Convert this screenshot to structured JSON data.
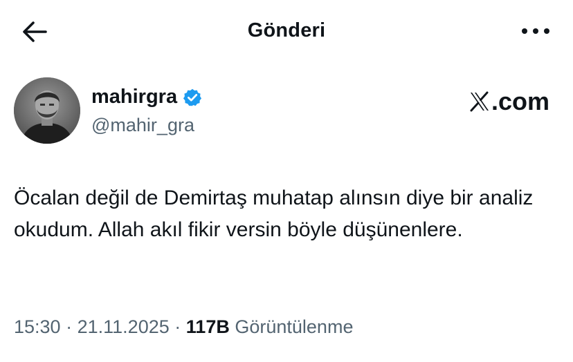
{
  "header": {
    "title": "Gönderi",
    "back_icon": "arrow-left-icon",
    "more_icon": "more-horizontal-icon"
  },
  "author": {
    "display_name": "mahirgra",
    "handle": "@mahir_gra",
    "verified": true,
    "verified_color": "#1d9bf0"
  },
  "brand": {
    "text": ".com",
    "logo_icon": "x-logo-icon"
  },
  "tweet": {
    "text": "Öcalan değil de Demirtaş muhatap alınsın diye bir analiz okudum. Allah akıl fikir versin böyle düşünenlere."
  },
  "meta": {
    "time": "15:30",
    "date": "21.11.2025",
    "separator": "·",
    "views_count": "117B",
    "views_label": "Görüntülenme"
  },
  "colors": {
    "text_primary": "#0f1419",
    "text_secondary": "#536471",
    "background": "#ffffff"
  }
}
